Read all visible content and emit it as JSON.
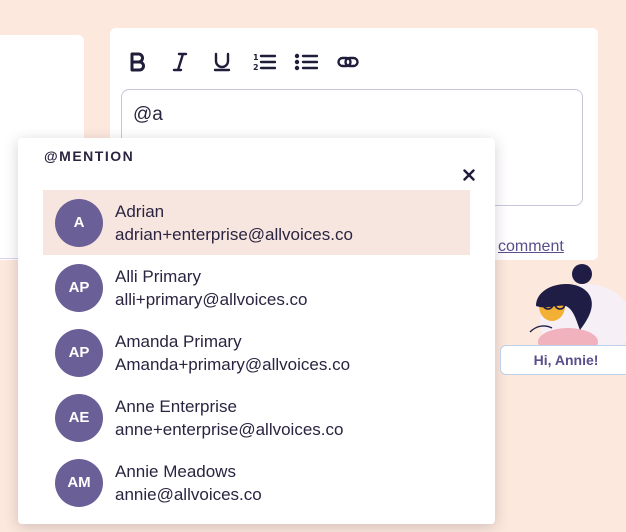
{
  "editor": {
    "input_value": "@a",
    "comment_link": "comment",
    "toolbar": [
      {
        "name": "bold-button",
        "icon": "bold-icon"
      },
      {
        "name": "italic-button",
        "icon": "italic-icon"
      },
      {
        "name": "underline-button",
        "icon": "underline-icon"
      },
      {
        "name": "ordered-list-button",
        "icon": "ordered-list-icon"
      },
      {
        "name": "bullet-list-button",
        "icon": "bullet-list-icon"
      },
      {
        "name": "link-button",
        "icon": "link-icon"
      }
    ]
  },
  "mention": {
    "title": "@MENTION",
    "close_icon": "close-icon",
    "items": [
      {
        "initials": "A",
        "name": "Adrian",
        "email": "adrian+enterprise@allvoices.co",
        "active": true
      },
      {
        "initials": "AP",
        "name": "Alli Primary",
        "email": "alli+primary@allvoices.co",
        "active": false
      },
      {
        "initials": "AP",
        "name": "Amanda Primary",
        "email": "Amanda+primary@allvoices.co",
        "active": false
      },
      {
        "initials": "AE",
        "name": "Anne Enterprise",
        "email": "anne+enterprise@allvoices.co",
        "active": false
      },
      {
        "initials": "AM",
        "name": "Annie Meadows",
        "email": "annie@allvoices.co",
        "active": false
      }
    ]
  },
  "assistant": {
    "greeting": "Hi, Annie!"
  },
  "colors": {
    "page_bg": "#fce8dc",
    "avatar_bg": "#6a5f97",
    "active_row_bg": "#f7e6e0",
    "accent": "#5a4e8c"
  }
}
